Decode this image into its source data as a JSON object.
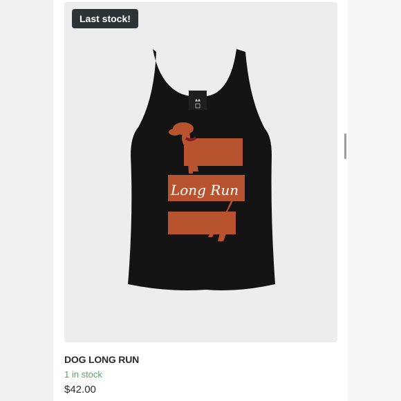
{
  "product": {
    "badge": "Last stock!",
    "title": "DOG LONG RUN",
    "stock": "1 in stock",
    "price": "$42.00",
    "graphic_text": "Long Run",
    "image_icon": "tank-top-image"
  },
  "colors": {
    "badge_bg": "#2e3335",
    "stock_green": "#5aa469",
    "shirt": "#141414",
    "print_orange": "#b8532f"
  }
}
